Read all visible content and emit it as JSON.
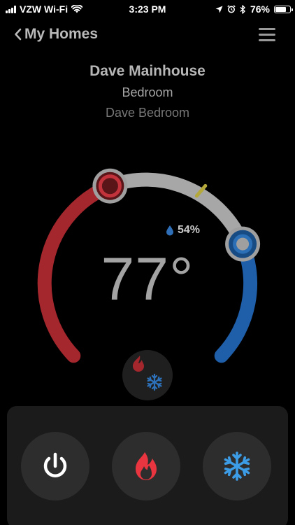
{
  "status_bar": {
    "carrier": "VZW Wi-Fi",
    "time": "3:23 PM",
    "battery": "76%",
    "battery_level": 0.76,
    "icons": [
      "signal-bars-icon",
      "wifi-icon",
      "location-arrow-icon",
      "alarm-icon",
      "bluetooth-icon",
      "battery-icon"
    ]
  },
  "header": {
    "back_label": "My Homes",
    "back_icon": "chevron-left-icon",
    "menu_icon": "hamburger-menu-icon"
  },
  "device": {
    "home_name": "Dave Mainhouse",
    "room": "Bedroom",
    "thermostat_name": "Dave Bedroom"
  },
  "thermostat": {
    "temperature": "77°",
    "humidity": "54%",
    "humidity_icon": "water-drop-icon",
    "mode_icon": "heat-cool-icon",
    "heat_color": "#a5272e",
    "cool_color": "#1f5ea9",
    "track_color": "#a7a7a7",
    "marker_color": "#b5a83a"
  },
  "controls": {
    "power_icon": "power-icon",
    "heat_icon": "flame-icon",
    "cool_icon": "snowflake-icon",
    "power_color": "#ffffff",
    "heat_color": "#e8353f",
    "cool_color": "#3d9ce6"
  }
}
